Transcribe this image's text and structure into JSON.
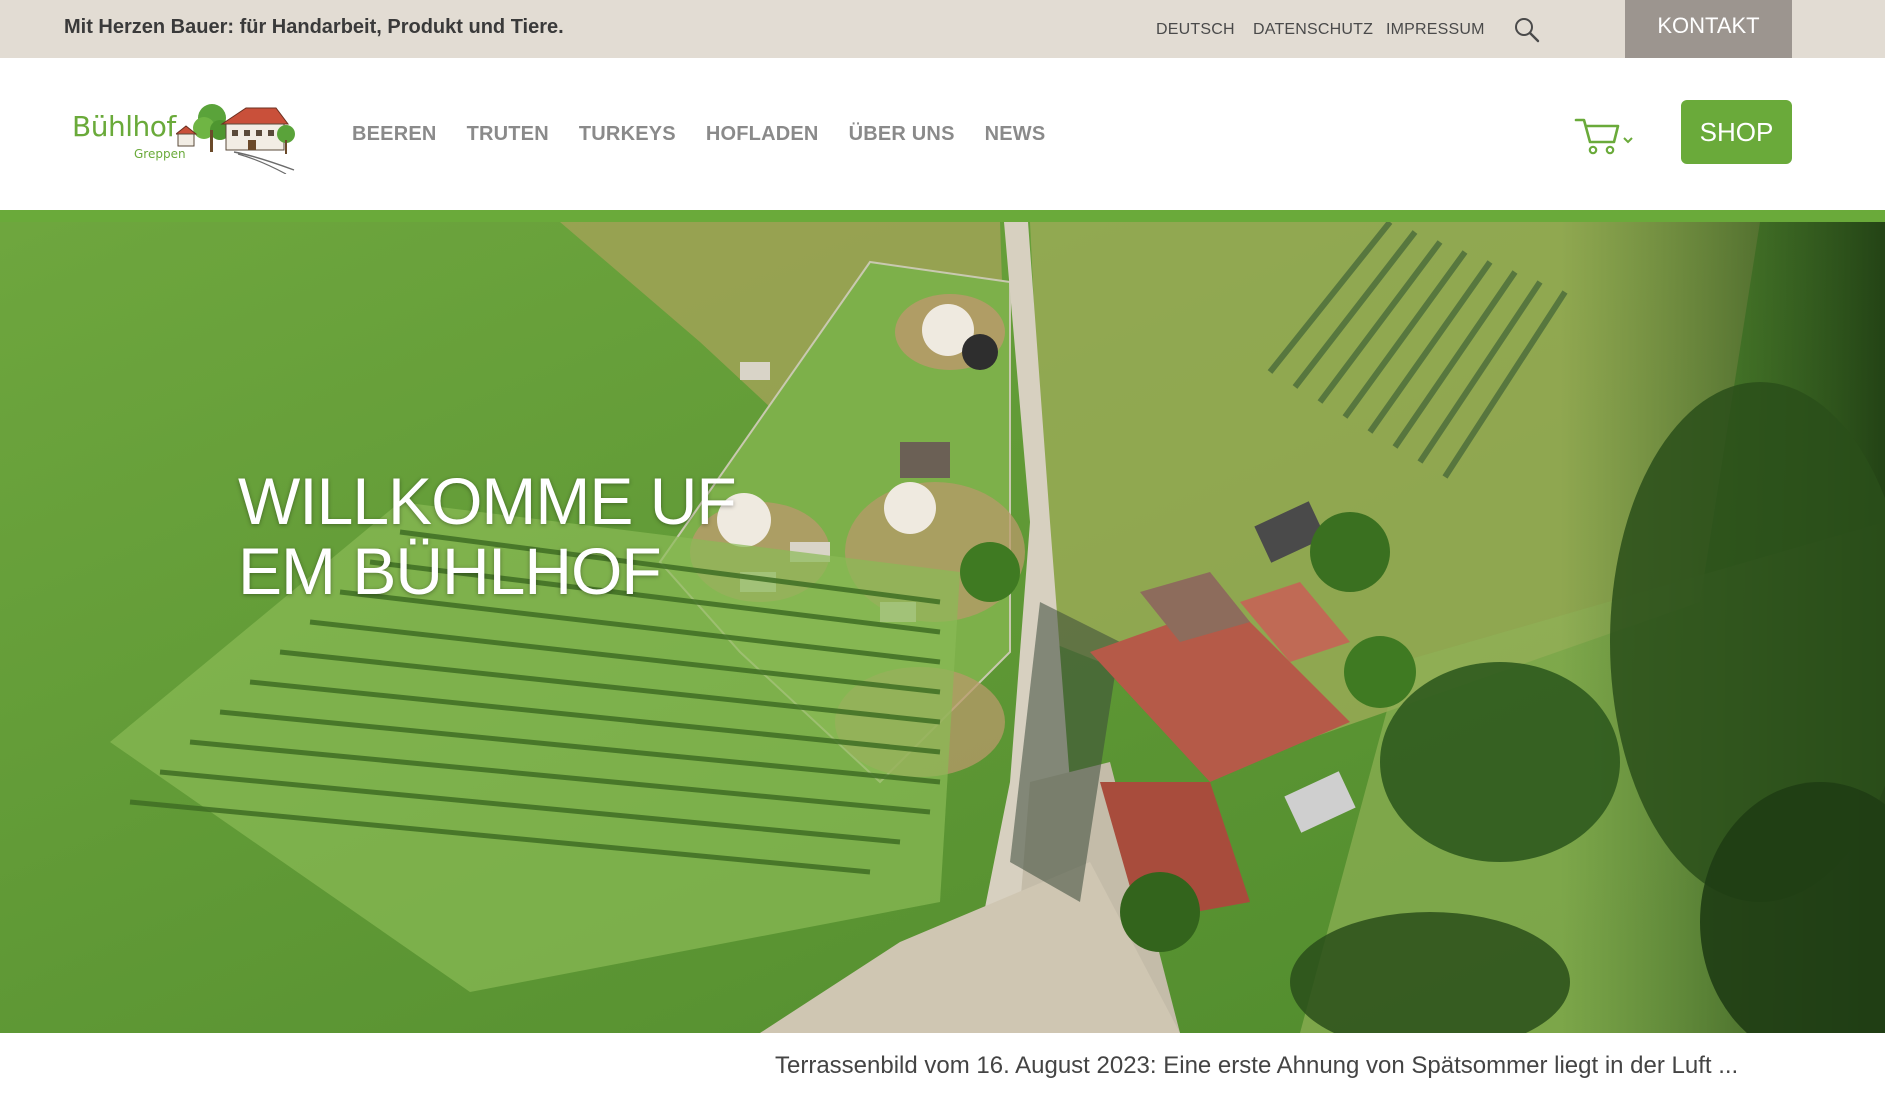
{
  "topbar": {
    "tagline": "Mit Herzen Bauer: für Handarbeit, Produkt und Tiere.",
    "links": {
      "language": "DEUTSCH",
      "privacy": "DATENSCHUTZ",
      "imprint": "IMPRESSUM"
    },
    "contact_label": "KONTAKT"
  },
  "logo": {
    "name": "Bühlhof",
    "subtitle": "Greppen"
  },
  "nav": {
    "items": [
      {
        "label": "BEEREN"
      },
      {
        "label": "TRUTEN"
      },
      {
        "label": "TURKEYS"
      },
      {
        "label": "HOFLADEN"
      },
      {
        "label": "ÜBER UNS"
      },
      {
        "label": "NEWS"
      }
    ]
  },
  "header": {
    "cart_icon": "shopping-cart-icon",
    "shop_label": "SHOP"
  },
  "hero": {
    "title": "WILLKOMME UF\nEM BÜHLHOF"
  },
  "caption": {
    "text": "Terrassenbild vom 16. August 2023: Eine erste Ahnung von Spätsommer liegt in der Luft ..."
  },
  "colors": {
    "brand_green": "#6aaa3a",
    "topbar_bg": "#e2dcd3",
    "contact_bg": "#9c958f",
    "nav_text": "#8a8a8a"
  }
}
